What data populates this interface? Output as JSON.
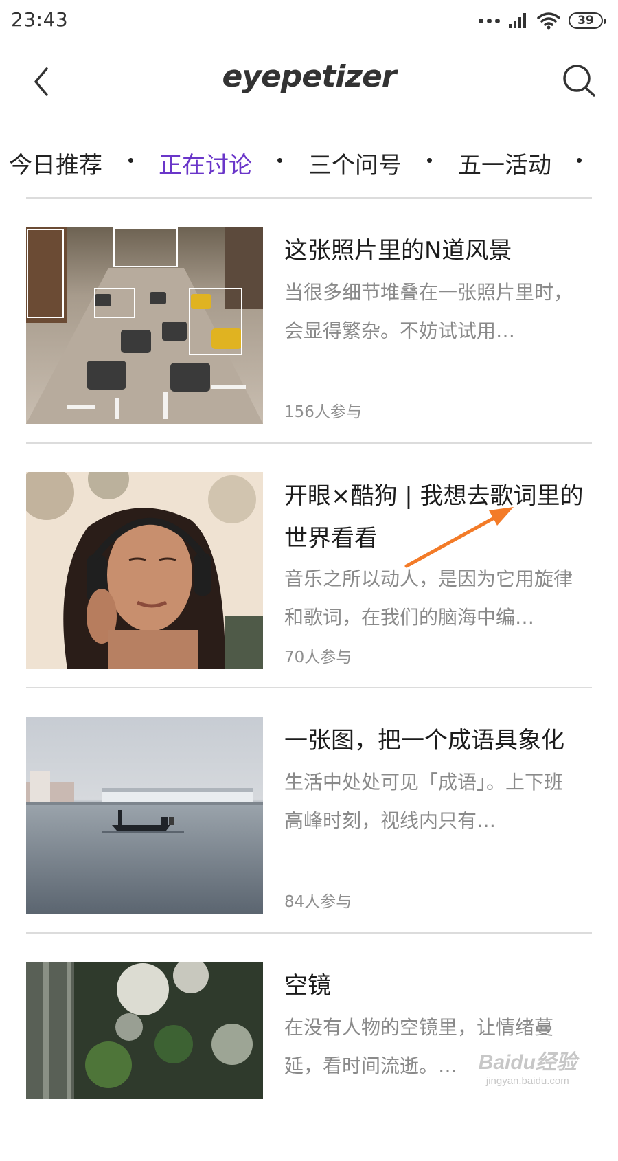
{
  "status_bar": {
    "time": "23:43",
    "battery": "39"
  },
  "header": {
    "logo": "eyepetizer",
    "back_icon": "chevron-left-icon",
    "search_icon": "search-icon"
  },
  "tabs": [
    {
      "label": "今日推荐",
      "active": false
    },
    {
      "label": "正在讨论",
      "active": true
    },
    {
      "label": "三个问号",
      "active": false
    },
    {
      "label": "五一活动",
      "active": false
    }
  ],
  "accent_color": "#6a36c9",
  "items": [
    {
      "title": "这张照片里的N道风景",
      "desc": "当很多细节堆叠在一张照片里时，会显得繁杂。不妨试试用…",
      "count": "156人参与"
    },
    {
      "title": "开眼×酷狗 | 我想去歌词里的世界看看",
      "desc": "音乐之所以动人，是因为它用旋律和歌词，在我们的脑海中编…",
      "count": "70人参与"
    },
    {
      "title": "一张图，把一个成语具象化",
      "desc": "生活中处处可见「成语」。上下班高峰时刻，视线内只有…",
      "count": "84人参与"
    },
    {
      "title": "空镜",
      "desc": "在没有人物的空镜里，让情绪蔓延，看时间流逝。…",
      "count": ""
    }
  ],
  "watermark": {
    "main": "Baidu经验",
    "sub": "jingyan.baidu.com"
  }
}
